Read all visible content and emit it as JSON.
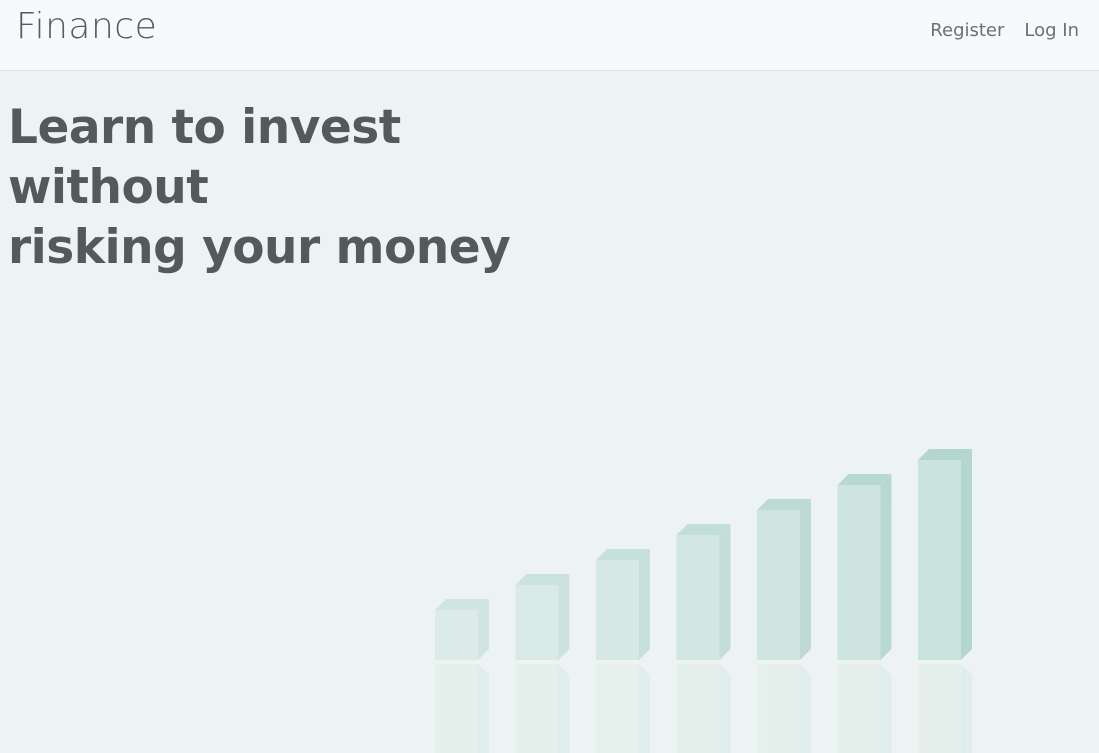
{
  "navbar": {
    "brand": "Finance",
    "links": [
      {
        "label": "Register"
      },
      {
        "label": "Log In"
      }
    ]
  },
  "hero": {
    "title_line1": "Learn to invest without",
    "title_line2": "risking your money"
  },
  "decor": {
    "bar_front_color": "#c8e2dc",
    "bar_side_color": "#afd5cc",
    "bar_levels": [
      1,
      2,
      3,
      4,
      5,
      6,
      7
    ]
  }
}
